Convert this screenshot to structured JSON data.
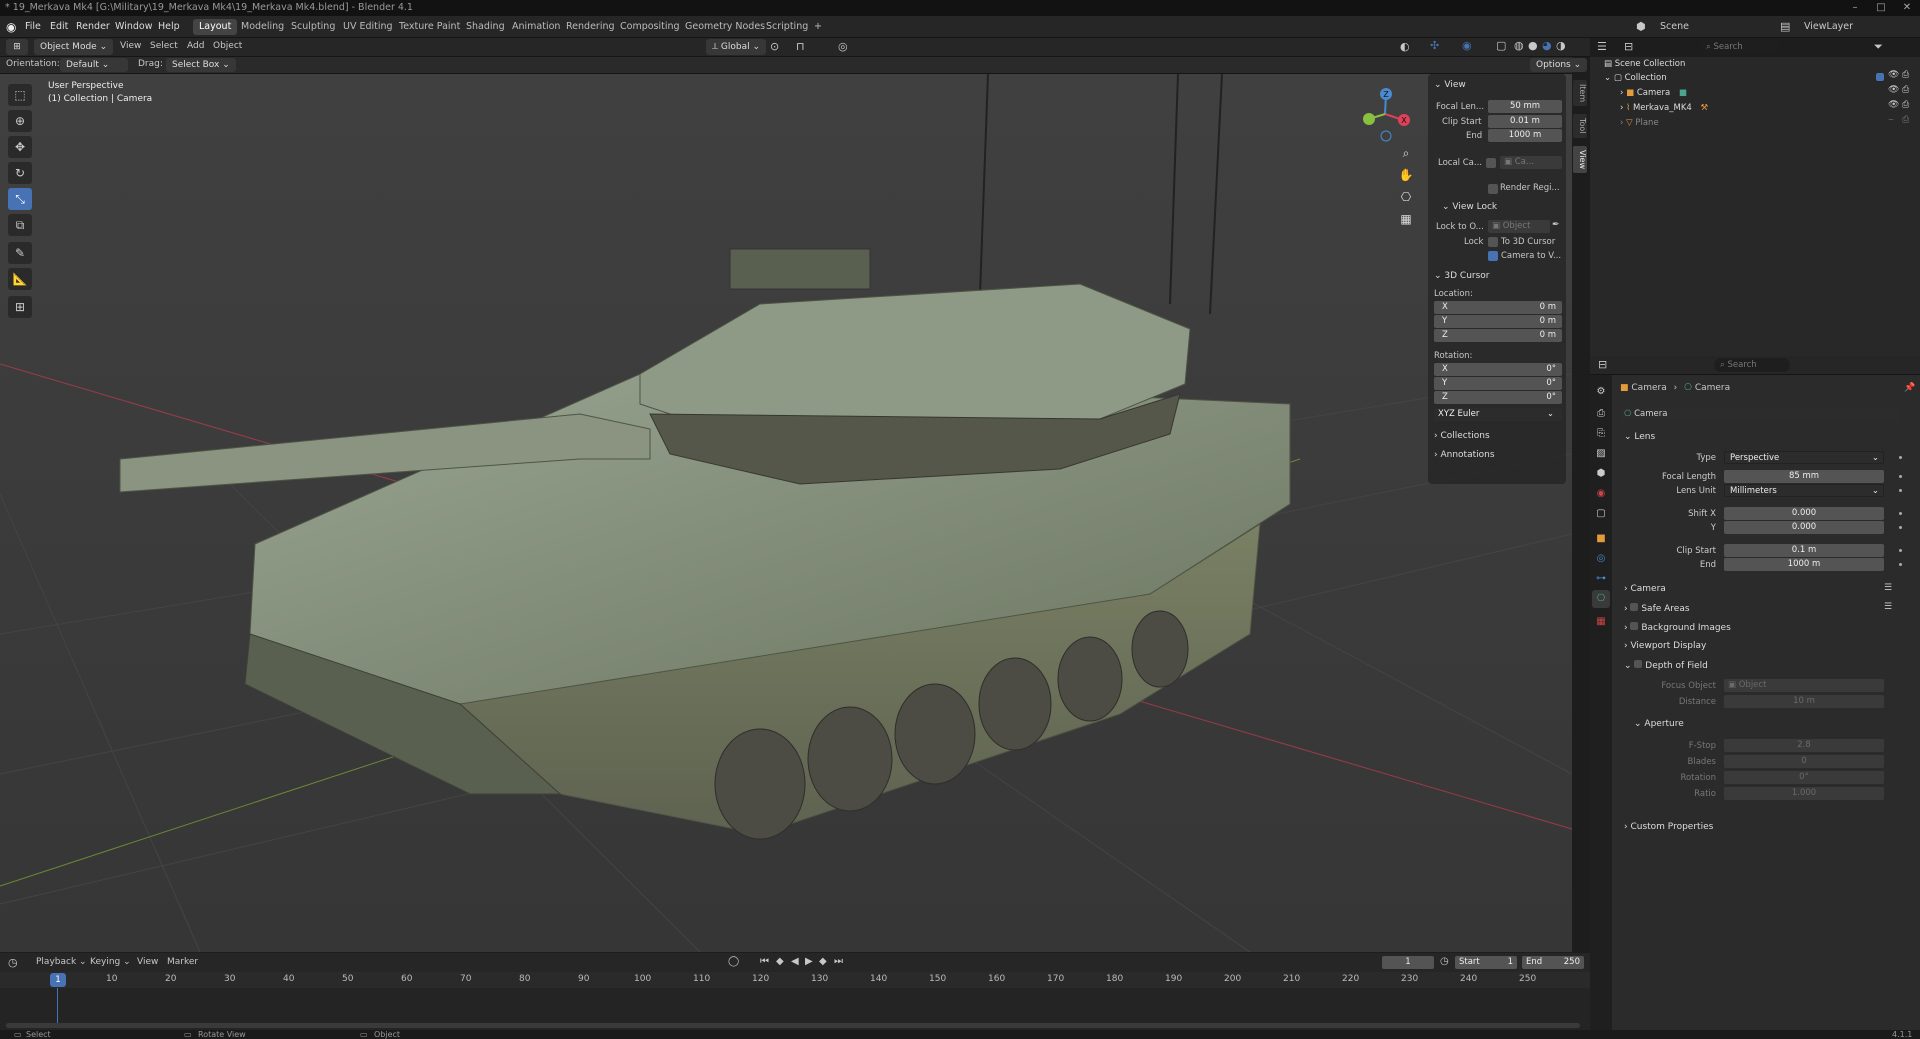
{
  "window": {
    "title": "* 19_Merkava Mk4 [G:\\Military\\19_Merkava Mk4\\19_Merkava Mk4.blend] - Blender 4.1"
  },
  "menu": {
    "items": [
      "File",
      "Edit",
      "Render",
      "Window",
      "Help"
    ]
  },
  "workspaces": {
    "tabs": [
      "Layout",
      "Modeling",
      "Sculpting",
      "UV Editing",
      "Texture Paint",
      "Shading",
      "Animation",
      "Rendering",
      "Compositing",
      "Geometry Nodes",
      "Scripting"
    ],
    "add": "+"
  },
  "topright": {
    "scene_label": "Scene",
    "viewlayer_label": "ViewLayer"
  },
  "viewport_header": {
    "mode": "Object Mode",
    "menus": [
      "View",
      "Select",
      "Add",
      "Object"
    ],
    "transform": "Global",
    "search_placeholder": "Search"
  },
  "tool_settings": {
    "orientation_label": "Orientation:",
    "orientation_value": "Default",
    "drag_label": "Drag:",
    "drag_value": "Select Box",
    "options": "Options"
  },
  "viewport": {
    "title": "User Perspective",
    "subtitle": "(1) Collection | Camera",
    "gizmo": {
      "x": "X",
      "y": "Y",
      "z": "Z"
    }
  },
  "npanel": {
    "tabs": [
      "Item",
      "Tool",
      "View"
    ],
    "view": {
      "header": "View",
      "focal_label": "Focal Len...",
      "focal_value": "50 mm",
      "clip_start_label": "Clip Start",
      "clip_start_value": "0.01 m",
      "end_label": "End",
      "end_value": "1000 m",
      "local_camera_label": "Local Ca...",
      "local_camera_value": "Ca...",
      "render_region": "Render Regi..."
    },
    "view_lock": {
      "header": "View Lock",
      "lock_to_label": "Lock to O...",
      "lock_to_value": "Object",
      "lock_label": "Lock",
      "to_3d_cursor": "To 3D Cursor",
      "camera_to_view": "Camera to V..."
    },
    "cursor": {
      "header": "3D Cursor",
      "location_label": "Location:",
      "rotation_label": "Rotation:",
      "axes": [
        "X",
        "Y",
        "Z"
      ],
      "location": [
        "0 m",
        "0 m",
        "0 m"
      ],
      "rotation": [
        "0°",
        "0°",
        "0°"
      ],
      "mode": "XYZ Euler"
    },
    "collections": "Collections",
    "annotations": "Annotations"
  },
  "outliner": {
    "search_placeholder": "Search",
    "items": [
      {
        "label": "Scene Collection",
        "icon": "scene-collection-icon"
      },
      {
        "label": "Collection",
        "icon": "collection-icon"
      },
      {
        "label": "Camera",
        "icon": "camera-object-icon"
      },
      {
        "label": "Merkava_MK4",
        "icon": "armature-icon"
      },
      {
        "label": "Plane",
        "icon": "mesh-icon"
      }
    ]
  },
  "properties": {
    "search_placeholder": "Search",
    "breadcrumb": [
      "Camera",
      "Camera"
    ],
    "datablock": "Camera",
    "lens": {
      "header": "Lens",
      "type_label": "Type",
      "type_value": "Perspective",
      "focal_label": "Focal Length",
      "focal_value": "85 mm",
      "unit_label": "Lens Unit",
      "unit_value": "Millimeters",
      "shiftx_label": "Shift X",
      "shiftx_value": "0.000",
      "shifty_label": "Y",
      "shifty_value": "0.000",
      "clip_start_label": "Clip Start",
      "clip_start_value": "0.1 m",
      "clip_end_label": "End",
      "clip_end_value": "1000 m"
    },
    "panels": [
      "Camera",
      "Safe Areas",
      "Background Images",
      "Viewport Display"
    ],
    "dof": {
      "header": "Depth of Field",
      "focus_label": "Focus Object",
      "focus_value": "Object",
      "distance_label": "Distance",
      "distance_value": "10 m",
      "aperture_header": "Aperture",
      "fstop_label": "F-Stop",
      "fstop_value": "2.8",
      "blades_label": "Blades",
      "blades_value": "0",
      "rotation_label": "Rotation",
      "rotation_value": "0°",
      "ratio_label": "Ratio",
      "ratio_value": "1.000"
    },
    "custom": "Custom Properties"
  },
  "timeline": {
    "menus": [
      "Playback",
      "Keying",
      "View",
      "Marker"
    ],
    "current_frame": "1",
    "start_label": "Start",
    "start_value": "1",
    "end_label": "End",
    "end_value": "250",
    "playhead": "1",
    "ticks": [
      "10",
      "20",
      "30",
      "40",
      "50",
      "60",
      "70",
      "80",
      "90",
      "100",
      "110",
      "120",
      "130",
      "140",
      "150",
      "160",
      "170",
      "180",
      "190",
      "200",
      "210",
      "220",
      "230",
      "240",
      "250"
    ]
  },
  "status": {
    "select": "Select",
    "rotate": "Rotate View",
    "object": "Object",
    "version": "4.1.1"
  },
  "colors": {
    "accent": "#4772b3",
    "x_axis": "#e0405a",
    "y_axis": "#8ac040",
    "z_axis": "#4a8ad0",
    "tank": "#7d8a72"
  }
}
